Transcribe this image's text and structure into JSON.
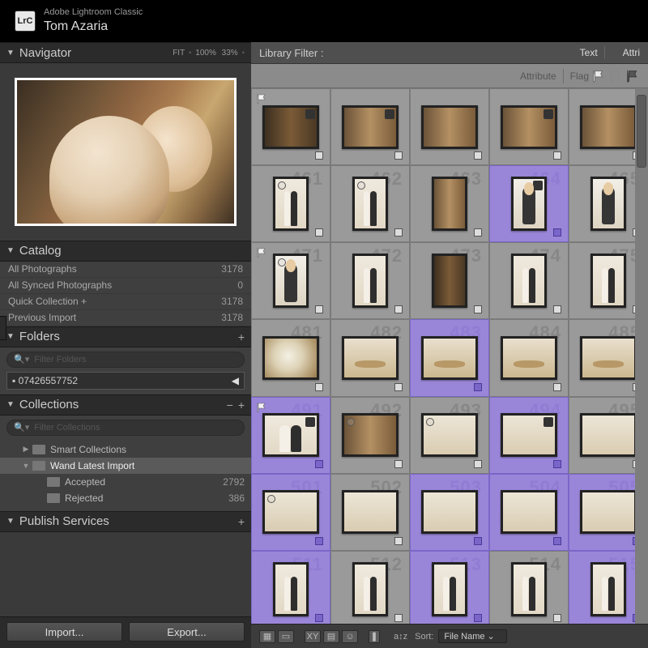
{
  "app": {
    "name": "Adobe Lightroom Classic",
    "logo": "LrC",
    "user": "Tom Azaria"
  },
  "navigator": {
    "title": "Navigator",
    "zoom": {
      "fit": "FIT",
      "full": "100%",
      "custom": "33%"
    }
  },
  "catalog": {
    "title": "Catalog",
    "rows": [
      {
        "label": "All Photographs",
        "count": "3178"
      },
      {
        "label": "All Synced Photographs",
        "count": "0"
      },
      {
        "label": "Quick Collection  +",
        "count": "3178"
      },
      {
        "label": "Previous Import",
        "count": "3178"
      }
    ]
  },
  "folders": {
    "title": "Folders",
    "search_placeholder": "Filter Folders",
    "disk": "07426557752"
  },
  "collections": {
    "title": "Collections",
    "search_placeholder": "Filter Collections",
    "items": [
      {
        "label": "Smart Collections",
        "count": "",
        "expanded": false,
        "level": 1
      },
      {
        "label": "Wand Latest Import",
        "count": "",
        "expanded": true,
        "level": 1,
        "selected": true
      },
      {
        "label": "Accepted",
        "count": "2792",
        "level": 2
      },
      {
        "label": "Rejected",
        "count": "386",
        "level": 2
      }
    ]
  },
  "publish": {
    "title": "Publish Services"
  },
  "buttons": {
    "import": "Import...",
    "export": "Export..."
  },
  "filter": {
    "label": "Library Filter :",
    "tabs": {
      "text": "Text",
      "attr": "Attri"
    },
    "attribute": "Attribute",
    "flag": "Flag"
  },
  "sort": {
    "label": "Sort:",
    "field": "File Name"
  },
  "grid": {
    "cells": [
      {
        "n": "",
        "sel": false,
        "o": "l",
        "scene": "hall",
        "flag": true,
        "badge": true
      },
      {
        "n": "",
        "sel": false,
        "o": "l",
        "scene": "close",
        "badge": true
      },
      {
        "n": "",
        "sel": false,
        "o": "l",
        "scene": "close"
      },
      {
        "n": "",
        "sel": false,
        "o": "l",
        "scene": "close",
        "badge": true
      },
      {
        "n": "",
        "sel": false,
        "o": "l",
        "scene": "close"
      },
      {
        "n": "461",
        "sel": false,
        "o": "p",
        "scene": "couple",
        "dot": true
      },
      {
        "n": "462",
        "sel": false,
        "o": "p",
        "scene": "couple",
        "dot": true
      },
      {
        "n": "463",
        "sel": false,
        "o": "p",
        "scene": "close"
      },
      {
        "n": "464",
        "sel": true,
        "o": "p",
        "scene": "white",
        "badge": true
      },
      {
        "n": "465",
        "sel": false,
        "o": "p",
        "scene": "white"
      },
      {
        "n": "471",
        "sel": false,
        "o": "p",
        "scene": "white",
        "dot": true,
        "flag": true
      },
      {
        "n": "472",
        "sel": false,
        "o": "p",
        "scene": "couple"
      },
      {
        "n": "473",
        "sel": false,
        "o": "p",
        "scene": "hall"
      },
      {
        "n": "474",
        "sel": false,
        "o": "p",
        "scene": "couple"
      },
      {
        "n": "475",
        "sel": false,
        "o": "p",
        "scene": "couple"
      },
      {
        "n": "481",
        "sel": false,
        "o": "l",
        "scene": "bouquet"
      },
      {
        "n": "482",
        "sel": false,
        "o": "l",
        "scene": "feet"
      },
      {
        "n": "483",
        "sel": true,
        "o": "l",
        "scene": "feet"
      },
      {
        "n": "484",
        "sel": false,
        "o": "l",
        "scene": "feet"
      },
      {
        "n": "485",
        "sel": false,
        "o": "l",
        "scene": "feet"
      },
      {
        "n": "491",
        "sel": true,
        "o": "l",
        "scene": "couple",
        "flag": true,
        "badge": true
      },
      {
        "n": "492",
        "sel": false,
        "o": "l",
        "scene": "close",
        "dot": true
      },
      {
        "n": "493",
        "sel": false,
        "o": "l",
        "scene": "group",
        "dot": true
      },
      {
        "n": "494",
        "sel": true,
        "o": "l",
        "scene": "group",
        "badge": true
      },
      {
        "n": "495",
        "sel": false,
        "o": "l",
        "scene": "group"
      },
      {
        "n": "501",
        "sel": true,
        "o": "l",
        "scene": "group",
        "dot": true
      },
      {
        "n": "502",
        "sel": false,
        "o": "l",
        "scene": "group"
      },
      {
        "n": "503",
        "sel": true,
        "o": "l",
        "scene": "group"
      },
      {
        "n": "504",
        "sel": true,
        "o": "l",
        "scene": "group"
      },
      {
        "n": "505",
        "sel": true,
        "o": "l",
        "scene": "group"
      },
      {
        "n": "511",
        "sel": true,
        "o": "p",
        "scene": "couple"
      },
      {
        "n": "512",
        "sel": false,
        "o": "p",
        "scene": "couple"
      },
      {
        "n": "513",
        "sel": true,
        "o": "p",
        "scene": "couple"
      },
      {
        "n": "514",
        "sel": false,
        "o": "p",
        "scene": "couple"
      },
      {
        "n": "515",
        "sel": true,
        "o": "p",
        "scene": "couple"
      }
    ]
  }
}
